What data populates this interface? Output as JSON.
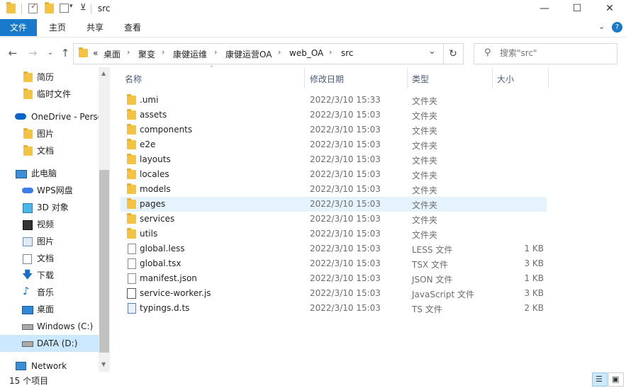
{
  "window": {
    "title": "src",
    "buttons": {
      "minimize": "—",
      "maximize": "☐",
      "close": "✕"
    }
  },
  "ribbon": {
    "tabs": [
      "文件",
      "主页",
      "共享",
      "查看"
    ],
    "expand_icon": "chevron-down",
    "help_icon": "?"
  },
  "address": {
    "overflow": "«",
    "crumbs": [
      "桌面",
      "聚变",
      "康健运维",
      "康健运营OA",
      "web_OA",
      "src"
    ],
    "sep": "›",
    "dropdown": "⌄",
    "refresh": "↻"
  },
  "search": {
    "placeholder": "搜索\"src\""
  },
  "sidebar": {
    "items": [
      {
        "label": "简历",
        "icon": "folder-icon"
      },
      {
        "label": "临时文件",
        "icon": "folder-icon"
      },
      {
        "label": "OneDrive - Personal",
        "icon": "cloud-icon"
      },
      {
        "label": "图片",
        "icon": "folder-icon"
      },
      {
        "label": "文档",
        "icon": "folder-icon"
      },
      {
        "label": "此电脑",
        "icon": "computer-icon"
      },
      {
        "label": "WPS网盘",
        "icon": "wps-cloud-icon"
      },
      {
        "label": "3D 对象",
        "icon": "3d-objects-icon"
      },
      {
        "label": "视频",
        "icon": "video-icon"
      },
      {
        "label": "图片",
        "icon": "pictures-icon"
      },
      {
        "label": "文档",
        "icon": "documents-icon"
      },
      {
        "label": "下载",
        "icon": "download-icon"
      },
      {
        "label": "音乐",
        "icon": "music-icon"
      },
      {
        "label": "桌面",
        "icon": "desktop-icon"
      },
      {
        "label": "Windows (C:)",
        "icon": "drive-icon"
      },
      {
        "label": "DATA (D:)",
        "icon": "drive-icon"
      },
      {
        "label": "Network",
        "icon": "network-icon"
      }
    ]
  },
  "columns": {
    "name": "名称",
    "date": "修改日期",
    "type": "类型",
    "size": "大小"
  },
  "files": [
    {
      "name": ".umi",
      "date": "2022/3/10 15:33",
      "type": "文件夹",
      "size": "",
      "icon": "folder-icon"
    },
    {
      "name": "assets",
      "date": "2022/3/10 15:03",
      "type": "文件夹",
      "size": "",
      "icon": "folder-icon"
    },
    {
      "name": "components",
      "date": "2022/3/10 15:03",
      "type": "文件夹",
      "size": "",
      "icon": "folder-icon"
    },
    {
      "name": "e2e",
      "date": "2022/3/10 15:03",
      "type": "文件夹",
      "size": "",
      "icon": "folder-icon"
    },
    {
      "name": "layouts",
      "date": "2022/3/10 15:03",
      "type": "文件夹",
      "size": "",
      "icon": "folder-icon"
    },
    {
      "name": "locales",
      "date": "2022/3/10 15:03",
      "type": "文件夹",
      "size": "",
      "icon": "folder-icon"
    },
    {
      "name": "models",
      "date": "2022/3/10 15:03",
      "type": "文件夹",
      "size": "",
      "icon": "folder-icon"
    },
    {
      "name": "pages",
      "date": "2022/3/10 15:03",
      "type": "文件夹",
      "size": "",
      "icon": "folder-icon"
    },
    {
      "name": "services",
      "date": "2022/3/10 15:03",
      "type": "文件夹",
      "size": "",
      "icon": "folder-icon"
    },
    {
      "name": "utils",
      "date": "2022/3/10 15:03",
      "type": "文件夹",
      "size": "",
      "icon": "folder-icon"
    },
    {
      "name": "global.less",
      "date": "2022/3/10 15:03",
      "type": "LESS 文件",
      "size": "1 KB",
      "icon": "file-icon"
    },
    {
      "name": "global.tsx",
      "date": "2022/3/10 15:03",
      "type": "TSX 文件",
      "size": "3 KB",
      "icon": "file-icon"
    },
    {
      "name": "manifest.json",
      "date": "2022/3/10 15:03",
      "type": "JSON 文件",
      "size": "1 KB",
      "icon": "file-icon"
    },
    {
      "name": "service-worker.js",
      "date": "2022/3/10 15:03",
      "type": "JavaScript 文件",
      "size": "3 KB",
      "icon": "js-file-icon"
    },
    {
      "name": "typings.d.ts",
      "date": "2022/3/10 15:03",
      "type": "TS 文件",
      "size": "2 KB",
      "icon": "ts-file-icon"
    }
  ],
  "status": {
    "count": "15 个项目"
  },
  "colors": {
    "accent": "#1979ca",
    "selected": "#cce8ff",
    "hover": "#e5f3ff",
    "folder": "#f5c342"
  }
}
